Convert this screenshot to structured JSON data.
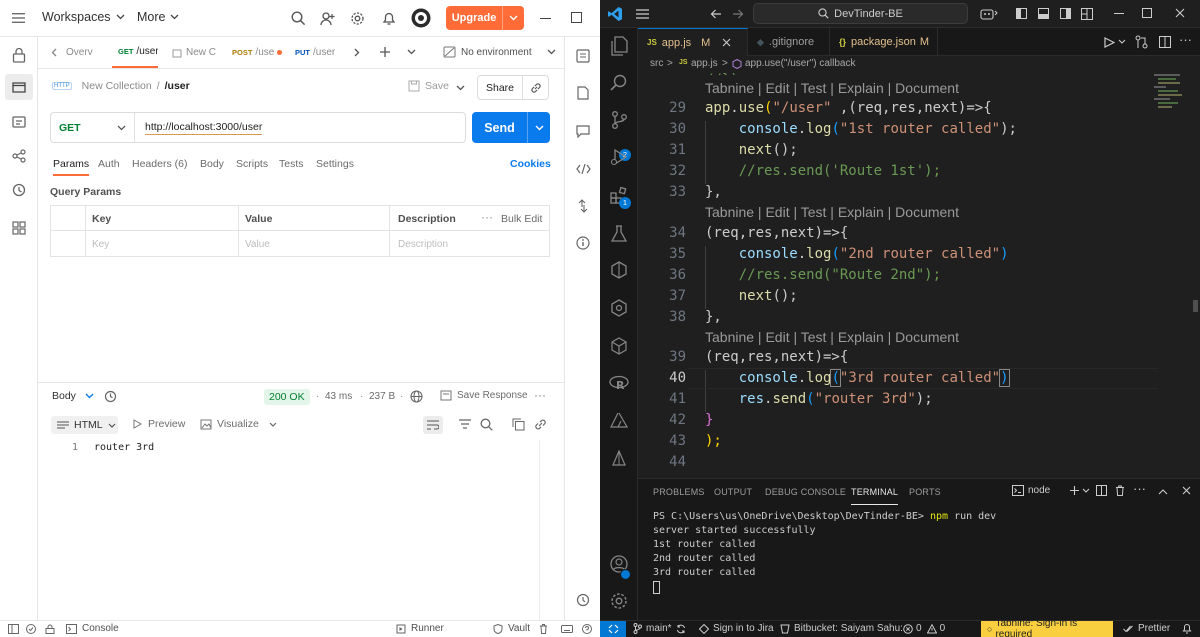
{
  "postman": {
    "topbar": {
      "workspaces": "Workspaces",
      "more": "More",
      "upgrade": "Upgrade"
    },
    "tabs": [
      {
        "method": "",
        "label": "Overv"
      },
      {
        "method": "GET",
        "label": "/user"
      },
      {
        "method": "",
        "label": "New C"
      },
      {
        "method": "POST",
        "label": "/use"
      },
      {
        "method": "PUT",
        "label": "/user"
      }
    ],
    "environment": "No environment",
    "breadcrumb": {
      "collection": "New Collection",
      "separator": "/",
      "request": "/user",
      "http_badge": "HTTP"
    },
    "save": "Save",
    "share": "Share",
    "request": {
      "method": "GET",
      "url": "http://localhost:3000/user",
      "send": "Send"
    },
    "subtabs": [
      "Params",
      "Auth",
      "Headers (6)",
      "Body",
      "Scripts",
      "Tests",
      "Settings"
    ],
    "cookies": "Cookies",
    "query_params": {
      "title": "Query Params",
      "headers": [
        "Key",
        "Value",
        "Description"
      ],
      "bulk_edit": "Bulk Edit",
      "placeholders": [
        "Key",
        "Value",
        "Description"
      ]
    },
    "response": {
      "body_label": "Body",
      "status": "200 OK",
      "time": "43 ms",
      "size": "237 B",
      "save_response": "Save Response",
      "format": "HTML",
      "preview": "Preview",
      "visualize": "Visualize",
      "line_number": "1",
      "content": "router 3rd"
    },
    "statusbar": {
      "console": "Console",
      "runner": "Runner",
      "vault": "Vault"
    }
  },
  "vscode": {
    "search": "DevTinder-BE",
    "tabs": [
      {
        "icon": "JS",
        "name": "app.js",
        "badge": "M"
      },
      {
        "icon": "",
        "name": ".gitignore",
        "badge": ""
      },
      {
        "icon": "{}",
        "name": "package.json",
        "badge": "M"
      }
    ],
    "breadcrumb": [
      "src",
      ">",
      "JS",
      "app.js",
      ">",
      "app.use(\"/user\") callback"
    ],
    "scm_badge": "2",
    "ext_badge": "1",
    "lens_text": "Tabnine | Edit | Test | Explain | Document",
    "line_numbers": [
      "29",
      "30",
      "31",
      "32",
      "33",
      "34",
      "35",
      "36",
      "37",
      "38",
      "39",
      "40",
      "41",
      "42",
      "43",
      "44"
    ],
    "current_line": "40",
    "code": {
      "l29": {
        "fn": "app",
        "dot": ".",
        "method": "use",
        "open": "(",
        "str": "\"/user\"",
        "rest": " ,(req,res,next)=>{"
      },
      "l30": {
        "obj": "console",
        "dot": ".",
        "method": "log",
        "open": "(",
        "str": "\"1st router called\"",
        "close": ");"
      },
      "l31": {
        "method": "next",
        "rest": "();"
      },
      "l32": {
        "comment": "//res.send('Route 1st');"
      },
      "l33": {
        "text": "},"
      },
      "l34": {
        "params": "(req,res,next)=>{"
      },
      "l35": {
        "obj": "console",
        "dot": ".",
        "method": "log",
        "open": "(",
        "str": "\"2nd router called\"",
        "close": ")"
      },
      "l36": {
        "comment": "//res.send(\"Route 2nd\");"
      },
      "l37": {
        "method": "next",
        "rest": "();"
      },
      "l38": {
        "text": "},"
      },
      "l39": {
        "params": "(req,res,next)=>{"
      },
      "l40": {
        "obj": "console",
        "dot": ".",
        "method": "log",
        "open": "(",
        "str": "\"3rd router called\"",
        "close": ")"
      },
      "l41": {
        "obj": "res",
        "dot": ".",
        "method": "send",
        "open": "(",
        "str": "\"router 3rd\"",
        "close": ");"
      },
      "l42": {
        "text": "}"
      },
      "l43": {
        "text": ");"
      },
      "l44": {
        "text": ""
      }
    },
    "panel_tabs": [
      "PROBLEMS",
      "OUTPUT",
      "DEBUG CONSOLE",
      "TERMINAL",
      "PORTS"
    ],
    "terminal_label": "node",
    "terminal": {
      "prompt": "PS C:\\Users\\us\\OneDrive\\Desktop\\DevTinder-BE>",
      "command": "npm",
      "command_arg": "run dev",
      "lines": [
        "server started successfully",
        "1st router called",
        "2nd router called",
        "3rd router called"
      ]
    },
    "status": {
      "branch": "main*",
      "jira": "Sign in to Jira",
      "bitbucket": "Bitbucket: Saiyam Sahu:",
      "errors": "0",
      "warnings": "0",
      "tabnine": "Tabnine: Sign-in is required",
      "prettier": "Prettier"
    },
    "colors": {
      "accent": "#0078d4",
      "tabnine_bg": "#f9cf3f"
    }
  },
  "colors": {
    "postman_orange": "#ff6c37",
    "send_blue": "#097bed",
    "ok_green": "#007f31"
  }
}
